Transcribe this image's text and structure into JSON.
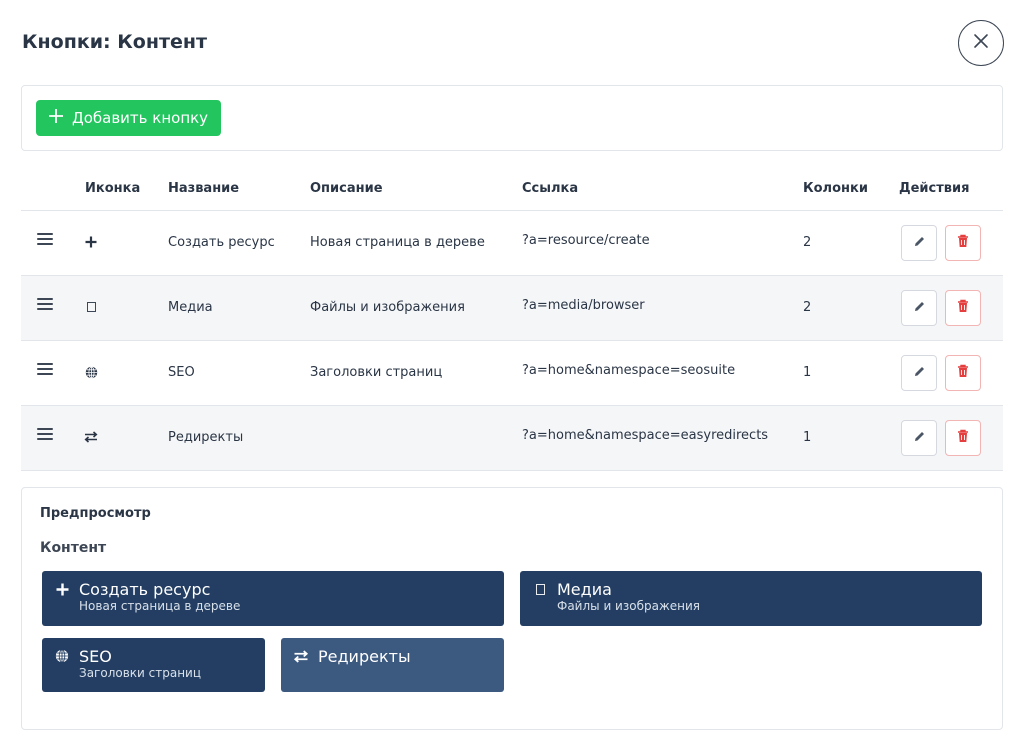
{
  "modal": {
    "title": "Кнопки: Контент",
    "close_icon": "close-icon"
  },
  "toolbar": {
    "add_label": "Добавить кнопку"
  },
  "table": {
    "headers": {
      "icon": "Иконка",
      "name": "Название",
      "description": "Описание",
      "link": "Ссылка",
      "columns": "Колонки",
      "actions": "Действия"
    },
    "rows": [
      {
        "icon": "plus-icon",
        "name": "Создать ресурс",
        "description": "Новая страница в дереве",
        "link": "?a=resource/create",
        "columns": "2"
      },
      {
        "icon": "image-icon",
        "name": "Медиа",
        "description": "Файлы и изображения",
        "link": "?a=media/browser",
        "columns": "2"
      },
      {
        "icon": "globe-icon",
        "name": "SEO",
        "description": "Заголовки страниц",
        "link": "?a=home&namespace=seosuite",
        "columns": "1"
      },
      {
        "icon": "exchange-icon",
        "name": "Редиректы",
        "description": "",
        "link": "?a=home&namespace=easyredirects",
        "columns": "1"
      }
    ]
  },
  "preview": {
    "label": "Предпросмотр",
    "section_title": "Контент",
    "tiles": [
      {
        "icon": "plus-icon",
        "title": "Создать ресурс",
        "subtitle": "Новая страница в дереве"
      },
      {
        "icon": "image-icon",
        "title": "Медиа",
        "subtitle": "Файлы и изображения"
      },
      {
        "icon": "globe-icon",
        "title": "SEO",
        "subtitle": "Заголовки страниц"
      },
      {
        "icon": "exchange-icon",
        "title": "Редиректы",
        "subtitle": ""
      }
    ]
  },
  "colors": {
    "primary_green": "#22c55e",
    "tile_dark": "#233e62",
    "tile_light": "#3c5980",
    "danger": "#e53e3e"
  }
}
